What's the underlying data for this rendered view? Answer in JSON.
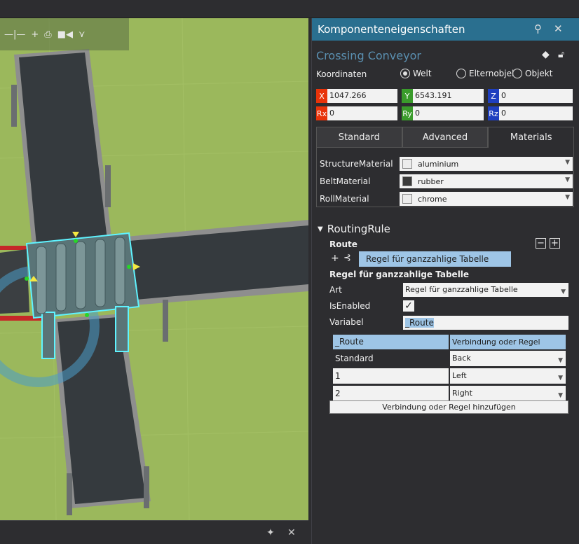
{
  "viewport": {
    "toolbar_icons": [
      "ruler-icon",
      "plus-icon",
      "pdf-icon",
      "camera-icon",
      "wifi-icon"
    ]
  },
  "bottom_panel": {
    "pin_glyph": "✦",
    "close_glyph": "✕"
  },
  "panel": {
    "title": "Komponenteneigenschaften",
    "component_name": "Crossing Conveyor",
    "coords_label": "Koordinaten",
    "frames": {
      "world": "Welt",
      "parent": "Elternobjel",
      "object": "Objekt",
      "selected": "world"
    },
    "coords": {
      "x": {
        "tag": "X",
        "value": "1047.266",
        "color": "#e8330a"
      },
      "y": {
        "tag": "Y",
        "value": "6543.191",
        "color": "#3a9b2b"
      },
      "z": {
        "tag": "Z",
        "value": "0",
        "color": "#1f3fbf"
      },
      "rx": {
        "tag": "Rx",
        "value": "0",
        "color": "#e8330a"
      },
      "ry": {
        "tag": "Ry",
        "value": "0",
        "color": "#3a9b2b"
      },
      "rz": {
        "tag": "Rz",
        "value": "0",
        "color": "#1f3fbf"
      }
    },
    "tabs": [
      "Standard",
      "Advanced",
      "Materials"
    ],
    "active_tab": "Materials",
    "materials": [
      {
        "label": "StructureMaterial",
        "value": "aluminium",
        "swatch": "#ececec"
      },
      {
        "label": "BeltMaterial",
        "value": "rubber",
        "swatch": "#3a3a3a"
      },
      {
        "label": "RollMaterial",
        "value": "chrome",
        "swatch": "#ececec"
      }
    ],
    "routing": {
      "section": "RoutingRule",
      "route_label": "Route",
      "route_value": "Regel für ganzzahlige Tabelle",
      "rule_title": "Regel für ganzzahlige Tabelle",
      "art_label": "Art",
      "art_value": "Regel für ganzzahlige Tabelle",
      "enabled_label": "IsEnabled",
      "enabled": true,
      "variable_label": "Variabel",
      "variable_value": "_Route",
      "table_headers": [
        "_Route",
        "Verbindung oder Regel"
      ],
      "table_rows": [
        {
          "key": "Standard",
          "value": "Back"
        },
        {
          "key": "1",
          "value": "Left"
        },
        {
          "key": "2",
          "value": "Right"
        }
      ],
      "add_button": "Verbindung oder Regel hinzufügen"
    }
  }
}
